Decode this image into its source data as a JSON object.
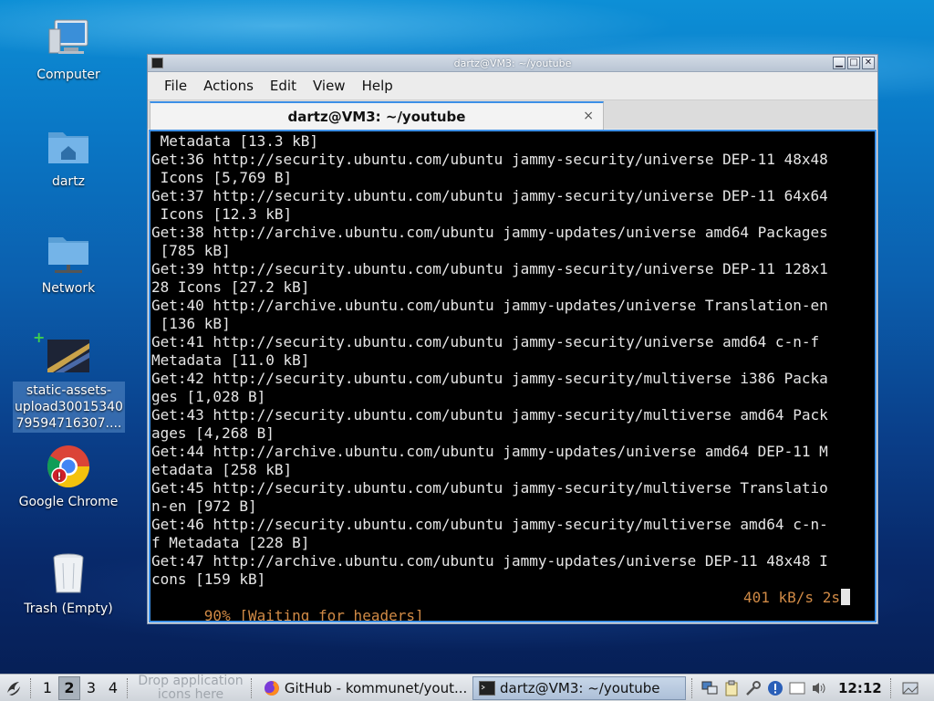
{
  "desktop": {
    "icons": [
      {
        "label": "Computer"
      },
      {
        "label": "dartz"
      },
      {
        "label": "Network"
      },
      {
        "label": "static-assets-upload300153407959471630 7...."
      },
      {
        "label": "Google Chrome"
      },
      {
        "label": "Trash (Empty)"
      }
    ],
    "selected_icon_lines": [
      "static-assets-",
      "upload30015340",
      "79594716307...."
    ]
  },
  "window": {
    "title": "dartz@VM3: ~/youtube",
    "buttons": {
      "minimize": "▁",
      "maximize": "□",
      "close": "✕"
    },
    "menu": [
      "File",
      "Actions",
      "Edit",
      "View",
      "Help"
    ],
    "tab": {
      "label": "dartz@VM3: ~/youtube",
      "close": "×"
    }
  },
  "terminal": {
    "lines": [
      " Metadata [13.3 kB]",
      "Get:36 http://security.ubuntu.com/ubuntu jammy-security/universe DEP-11 48x48",
      " Icons [5,769 B]",
      "Get:37 http://security.ubuntu.com/ubuntu jammy-security/universe DEP-11 64x64",
      " Icons [12.3 kB]",
      "Get:38 http://archive.ubuntu.com/ubuntu jammy-updates/universe amd64 Packages",
      " [785 kB]",
      "Get:39 http://security.ubuntu.com/ubuntu jammy-security/universe DEP-11 128x1",
      "28 Icons [27.2 kB]",
      "Get:40 http://archive.ubuntu.com/ubuntu jammy-updates/universe Translation-en",
      " [136 kB]",
      "Get:41 http://security.ubuntu.com/ubuntu jammy-security/universe amd64 c-n-f",
      "Metadata [11.0 kB]",
      "Get:42 http://security.ubuntu.com/ubuntu jammy-security/multiverse i386 Packa",
      "ges [1,028 B]",
      "Get:43 http://security.ubuntu.com/ubuntu jammy-security/multiverse amd64 Pack",
      "ages [4,268 B]",
      "Get:44 http://archive.ubuntu.com/ubuntu jammy-updates/universe amd64 DEP-11 M",
      "etadata [258 kB]",
      "Get:45 http://security.ubuntu.com/ubuntu jammy-security/multiverse Translatio",
      "n-en [972 B]",
      "Get:46 http://security.ubuntu.com/ubuntu jammy-security/multiverse amd64 c-n-",
      "f Metadata [228 B]",
      "Get:47 http://archive.ubuntu.com/ubuntu jammy-updates/universe DEP-11 48x48 I",
      "cons [159 kB]"
    ],
    "status": {
      "progress": "90% [Waiting for headers]",
      "speed": "401 kB/s 2s"
    },
    "colors": {
      "background": "#000000",
      "text": "#e6e6e6",
      "status": "#d08a46"
    }
  },
  "taskbar": {
    "workspaces": [
      "1",
      "2",
      "3",
      "4"
    ],
    "active_workspace": "2",
    "drop_hint": "Drop application icons here",
    "tasks": [
      {
        "label": "GitHub - kommunet/yout...",
        "icon": "firefox-icon"
      },
      {
        "label": "dartz@VM3: ~/youtube",
        "icon": "terminal-icon",
        "active": true
      }
    ],
    "clock": "12:12"
  }
}
